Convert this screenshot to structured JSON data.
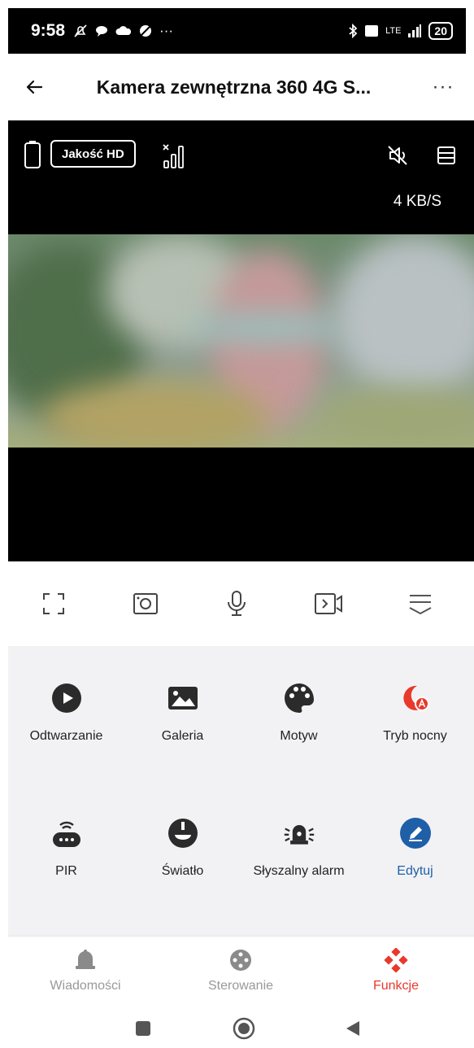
{
  "status_bar": {
    "time": "9:58",
    "overflow": "···",
    "network": "LTE",
    "battery": "20"
  },
  "header": {
    "title": "Kamera zewnętrzna 360 4G S...",
    "more": "···"
  },
  "video": {
    "quality_label": "Jakość HD",
    "speed": "4 KB/S"
  },
  "functions": [
    {
      "label": "Odtwarzanie",
      "icon": "play-icon"
    },
    {
      "label": "Galeria",
      "icon": "gallery-icon"
    },
    {
      "label": "Motyw",
      "icon": "palette-icon"
    },
    {
      "label": "Tryb nocny",
      "icon": "night-mode-icon"
    },
    {
      "label": "PIR",
      "icon": "pir-sensor-icon"
    },
    {
      "label": "Światło",
      "icon": "light-icon"
    },
    {
      "label": "Słyszalny alarm",
      "icon": "siren-icon"
    },
    {
      "label": "Edytuj",
      "icon": "edit-icon"
    }
  ],
  "bottom_nav": [
    {
      "label": "Wiadomości",
      "icon": "bell-icon",
      "active": false
    },
    {
      "label": "Sterowanie",
      "icon": "joystick-icon",
      "active": false
    },
    {
      "label": "Funkcje",
      "icon": "functions-icon",
      "active": true
    }
  ],
  "colors": {
    "accent_red": "#e8392c",
    "accent_blue": "#1f5fa8",
    "panel_bg": "#f2f2f4"
  }
}
